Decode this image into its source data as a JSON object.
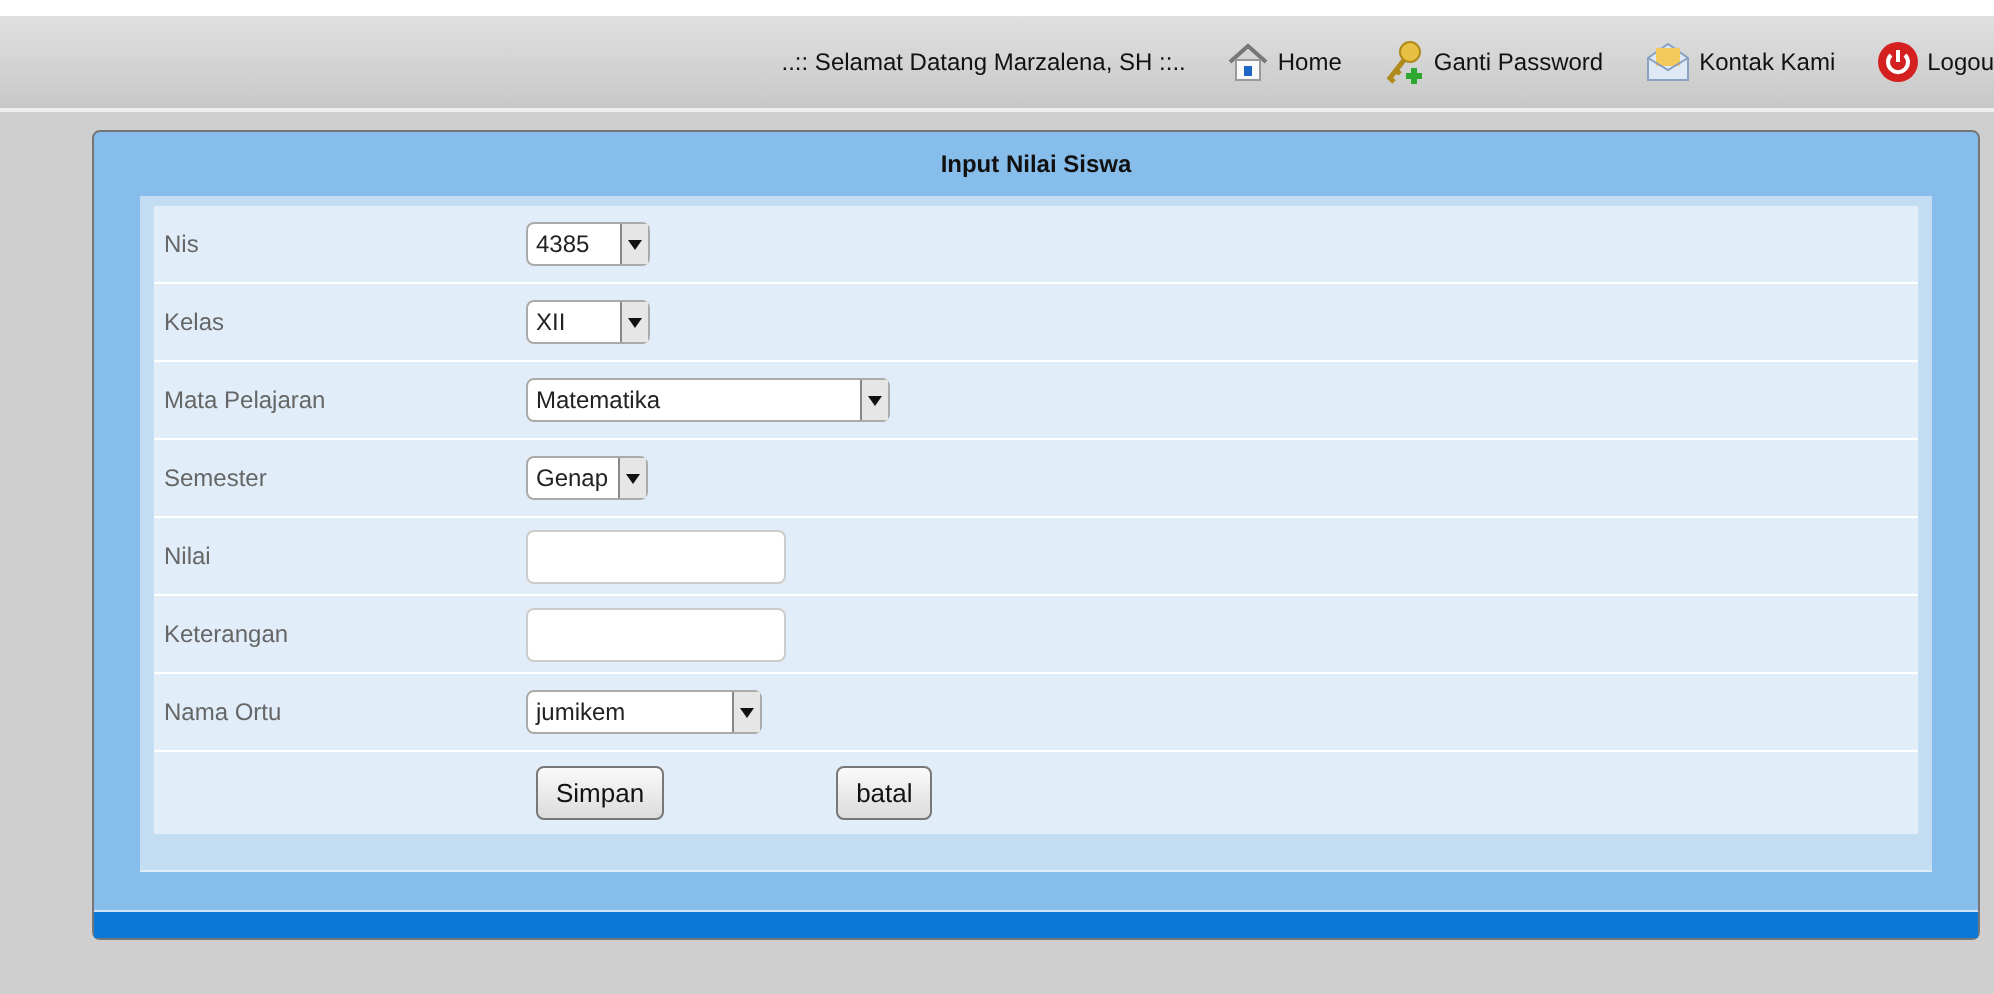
{
  "header": {
    "greeting": "..:: Selamat Datang Marzalena, SH ::..",
    "nav": [
      {
        "label": "Home",
        "kind": "home"
      },
      {
        "label": "Ganti Password",
        "kind": "key"
      },
      {
        "label": "Kontak Kami",
        "kind": "mail"
      },
      {
        "label": "Logou",
        "kind": "power"
      }
    ]
  },
  "form": {
    "title": "Input Nilai Siswa",
    "rows": [
      {
        "label": "Nis",
        "kind": "select",
        "value": "4385"
      },
      {
        "label": "Kelas",
        "kind": "select",
        "value": "XII"
      },
      {
        "label": "Mata Pelajaran",
        "kind": "select",
        "value": "Matematika"
      },
      {
        "label": "Semester",
        "kind": "select",
        "value": "Genap"
      },
      {
        "label": "Nilai",
        "kind": "text"
      },
      {
        "label": "Keterangan",
        "kind": "text"
      },
      {
        "label": "Nama Ortu",
        "kind": "select",
        "value": "jumikem"
      }
    ],
    "buttons": [
      "Simpan",
      "batal"
    ]
  }
}
